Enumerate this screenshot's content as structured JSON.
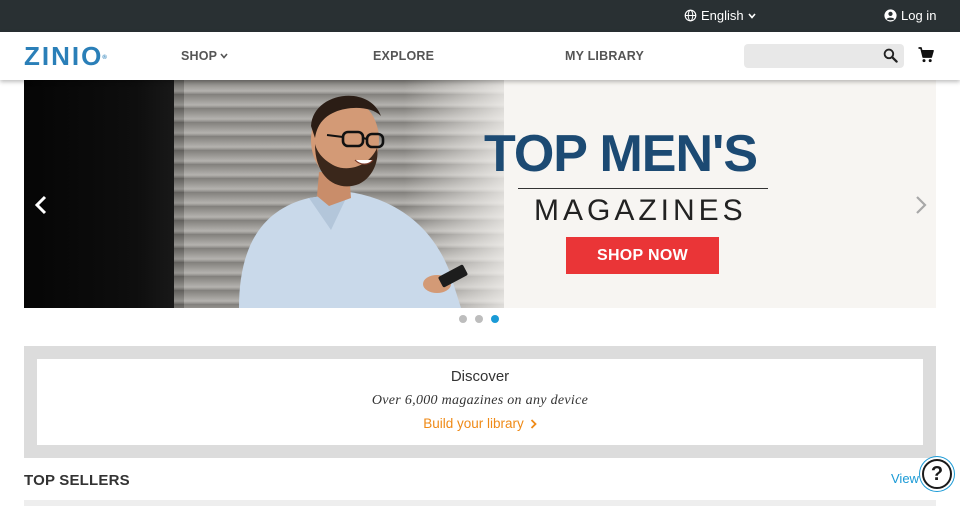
{
  "topbar": {
    "language": "English",
    "login": "Log in"
  },
  "nav": {
    "logo": "ZINIO",
    "logo_mark": "®",
    "items": [
      "SHOP",
      "EXPLORE",
      "MY LIBRARY"
    ],
    "search_placeholder": ""
  },
  "hero": {
    "title": "TOP MEN'S",
    "subtitle": "MAGAZINES",
    "cta": "SHOP NOW",
    "slide_count": 3,
    "active_slide": 3
  },
  "discover": {
    "title": "Discover",
    "subtitle": "Over 6,000 magazines on any device",
    "link": "Build your library"
  },
  "sellers": {
    "title": "TOP SELLERS",
    "view_all": "View all"
  },
  "help": {
    "label": "?"
  },
  "colors": {
    "brand": "#2a7fb8",
    "cta": "#ea3537",
    "link": "#ef8a17",
    "accent": "#1a9ad6",
    "topbar": "#293033"
  }
}
